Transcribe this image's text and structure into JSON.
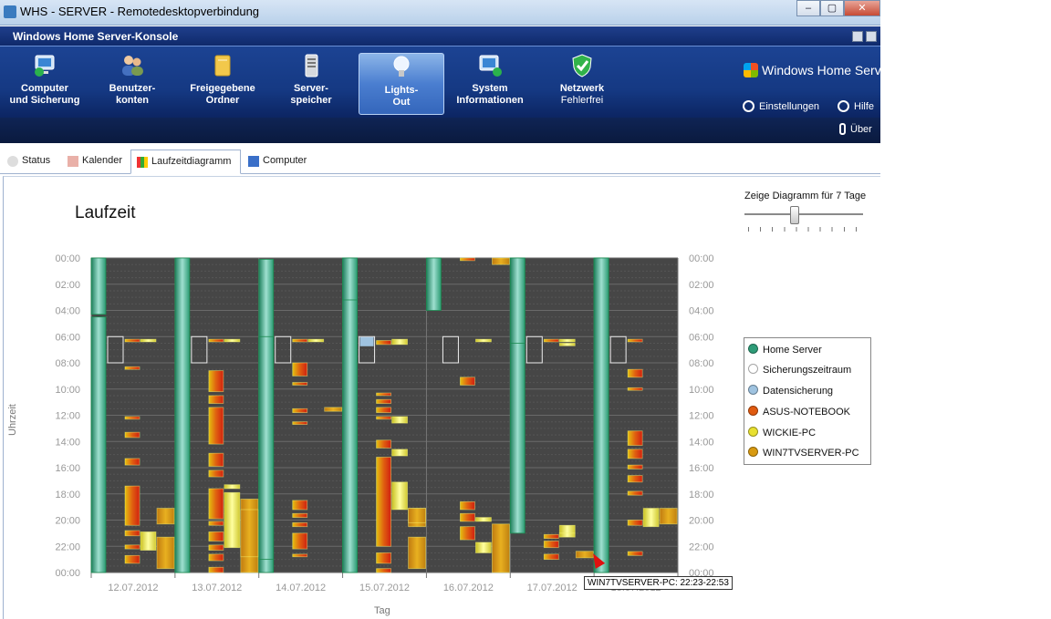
{
  "window": {
    "title": "WHS - SERVER - Remotedesktopverbindung",
    "console_title": "Windows Home Server-Konsole",
    "min": "–",
    "max": "▢",
    "close": "✕"
  },
  "toolbar": {
    "buttons": [
      {
        "line1": "Computer",
        "line2": "und Sicherung"
      },
      {
        "line1": "Benutzer-",
        "line2": "konten"
      },
      {
        "line1": "Freigegebene",
        "line2": "Ordner"
      },
      {
        "line1": "Server-",
        "line2": "speicher"
      },
      {
        "line1": "Lights-",
        "line2": "Out"
      },
      {
        "line1": "System",
        "line2": "Informationen"
      }
    ],
    "network": {
      "line1": "Netzwerk",
      "line2": "Fehlerfrei"
    },
    "logo": "Windows Home Server",
    "settings": "Einstellungen",
    "help": "Hilfe",
    "about": "Über"
  },
  "tabs": [
    "Status",
    "Kalender",
    "Laufzeitdiagramm",
    "Computer"
  ],
  "chart_heading": "Laufzeit",
  "slider": {
    "label": "Zeige Diagramm für 7 Tage",
    "days": 7
  },
  "legend": [
    {
      "name": "Home Server",
      "color": "#2e9c78"
    },
    {
      "name": "Sicherungszeitraum",
      "color": "#ffffff"
    },
    {
      "name": "Datensicherung",
      "color": "#9fc3e0"
    },
    {
      "name": "ASUS-NOTEBOOK",
      "color": "#e05a10"
    },
    {
      "name": "WICKIE-PC",
      "color": "#e8e030"
    },
    {
      "name": "WIN7TVSERVER-PC",
      "color": "#d89a10"
    }
  ],
  "tooltip": "WIN7TVSERVER-PC:  22:23-22:53",
  "chart_data": {
    "type": "bar",
    "xlabel": "Tag",
    "ylabel": "Uhrzeit",
    "categories": [
      "12.07.2012",
      "13.07.2012",
      "14.07.2012",
      "15.07.2012",
      "16.07.2012",
      "17.07.2012",
      "18.07.2012"
    ],
    "y_ticks": [
      "00:00",
      "02:00",
      "04:00",
      "06:00",
      "08:00",
      "10:00",
      "12:00",
      "14:00",
      "16:00",
      "18:00",
      "20:00",
      "22:00",
      "00:00"
    ],
    "ylim": [
      0,
      24
    ],
    "series": [
      {
        "name": "Home Server",
        "color": "#2e9c78",
        "lane": 0,
        "intervals": [
          [
            0,
            4.3
          ],
          [
            4.5,
            24
          ],
          [
            6,
            23.6
          ],
          [
            5.5,
            24
          ],
          [
            0,
            24
          ],
          [
            0.1,
            24
          ],
          [
            6,
            23
          ],
          [
            5,
            5.2
          ],
          [
            11.6,
            24
          ],
          [
            0,
            24
          ],
          [
            0,
            3.2
          ],
          [
            0,
            4
          ],
          [
            0,
            21
          ],
          [
            0,
            6.5
          ],
          [
            0,
            24
          ],
          [
            0,
            4
          ],
          [
            0,
            24
          ]
        ]
      },
      {
        "name": "Sicherungszeitraum",
        "color": "#ffffff",
        "lane": 1,
        "intervals": [
          [
            6,
            8
          ],
          [
            6,
            8
          ],
          [
            6,
            8
          ],
          [
            6,
            8
          ],
          [
            6,
            8
          ],
          [
            6,
            8
          ],
          [
            6,
            8
          ]
        ]
      },
      {
        "name": "Datensicherung",
        "color": "#9fc3e0",
        "lane": 1,
        "intervals": [
          [
            6,
            6.7
          ]
        ]
      },
      {
        "name": "ASUS-NOTEBOOK",
        "color": "#e05a10",
        "lane": 2,
        "intervals": [
          [
            6.2,
            6.4
          ],
          [
            8.3,
            8.5
          ],
          [
            12.1,
            12.3
          ],
          [
            13.3,
            13.7
          ],
          [
            15.3,
            15.8
          ],
          [
            17.4,
            20.4
          ],
          [
            20.8,
            21.2
          ],
          [
            21.9,
            22.2
          ],
          [
            22.7,
            23.3
          ],
          [
            6.2,
            6.4
          ],
          [
            8.6,
            10.2
          ],
          [
            10.5,
            11.1
          ],
          [
            11.4,
            14.2
          ],
          [
            14.9,
            15.9
          ],
          [
            16.2,
            16.7
          ],
          [
            17.6,
            19.9
          ],
          [
            20.1,
            20.4
          ],
          [
            20.9,
            21.6
          ],
          [
            21.9,
            22.3
          ],
          [
            22.6,
            23.1
          ],
          [
            23.6,
            24
          ],
          [
            6.2,
            6.4
          ],
          [
            8,
            9
          ],
          [
            9.5,
            9.7
          ],
          [
            11.5,
            11.8
          ],
          [
            12.5,
            12.7
          ],
          [
            18.5,
            19.2
          ],
          [
            19.5,
            19.8
          ],
          [
            20.2,
            20.5
          ],
          [
            21,
            22.2
          ],
          [
            22.6,
            22.8
          ],
          [
            6.3,
            6.6
          ],
          [
            10.3,
            10.5
          ],
          [
            10.8,
            11.1
          ],
          [
            11.4,
            11.8
          ],
          [
            12.1,
            12.3
          ],
          [
            13.9,
            14.5
          ],
          [
            15.2,
            22
          ],
          [
            22.5,
            23.3
          ],
          [
            23.7,
            24
          ],
          [
            0,
            0.2
          ],
          [
            9.1,
            9.7
          ],
          [
            18.6,
            19.2
          ],
          [
            19.5,
            20.1
          ],
          [
            20.5,
            21.5
          ],
          [
            22.6,
            23
          ],
          [
            6.2,
            6.4
          ],
          [
            21.1,
            21.4
          ],
          [
            21.6,
            22.1
          ],
          [
            22.4,
            22.7
          ],
          [
            6.2,
            6.4
          ],
          [
            8.5,
            9.1
          ],
          [
            9.9,
            10.1
          ],
          [
            13.2,
            14.3
          ],
          [
            14.6,
            15.3
          ],
          [
            15.8,
            16.1
          ],
          [
            16.6,
            17.1
          ],
          [
            17.8,
            18.1
          ],
          [
            20.0,
            20.4
          ]
        ]
      },
      {
        "name": "WICKIE-PC",
        "color": "#e8e030",
        "lane": 3,
        "intervals": [
          [
            6.2,
            6.4
          ],
          [
            20.9,
            22.3
          ],
          [
            6.2,
            6.4
          ],
          [
            17.3,
            17.6
          ],
          [
            17.9,
            22.1
          ],
          [
            6.2,
            6.4
          ],
          [
            6.2,
            6.6
          ],
          [
            12.1,
            12.6
          ],
          [
            14.6,
            15.1
          ],
          [
            17.1,
            19.2
          ],
          [
            6.2,
            6.4
          ],
          [
            21.7,
            22.5
          ],
          [
            19.8,
            20.1
          ],
          [
            20.4,
            21
          ],
          [
            6.2,
            6.4
          ],
          [
            6.5,
            6.7
          ],
          [
            21,
            21.3
          ],
          [
            19.1,
            20.5
          ]
        ]
      },
      {
        "name": "WIN7TVSERVER-PC",
        "color": "#d89a10",
        "lane": 4,
        "intervals": [
          [
            19.1,
            20.3
          ],
          [
            21.3,
            23.7
          ],
          [
            18.4,
            24
          ],
          [
            19.2,
            22.8
          ],
          [
            11.4,
            11.7
          ],
          [
            19.1,
            20.5
          ],
          [
            21.3,
            23.7
          ],
          [
            19.1,
            20.2
          ],
          [
            20.3,
            24
          ],
          [
            0,
            0.5
          ],
          [
            22.38,
            22.88
          ],
          [
            19.1,
            20.3
          ]
        ]
      }
    ]
  }
}
